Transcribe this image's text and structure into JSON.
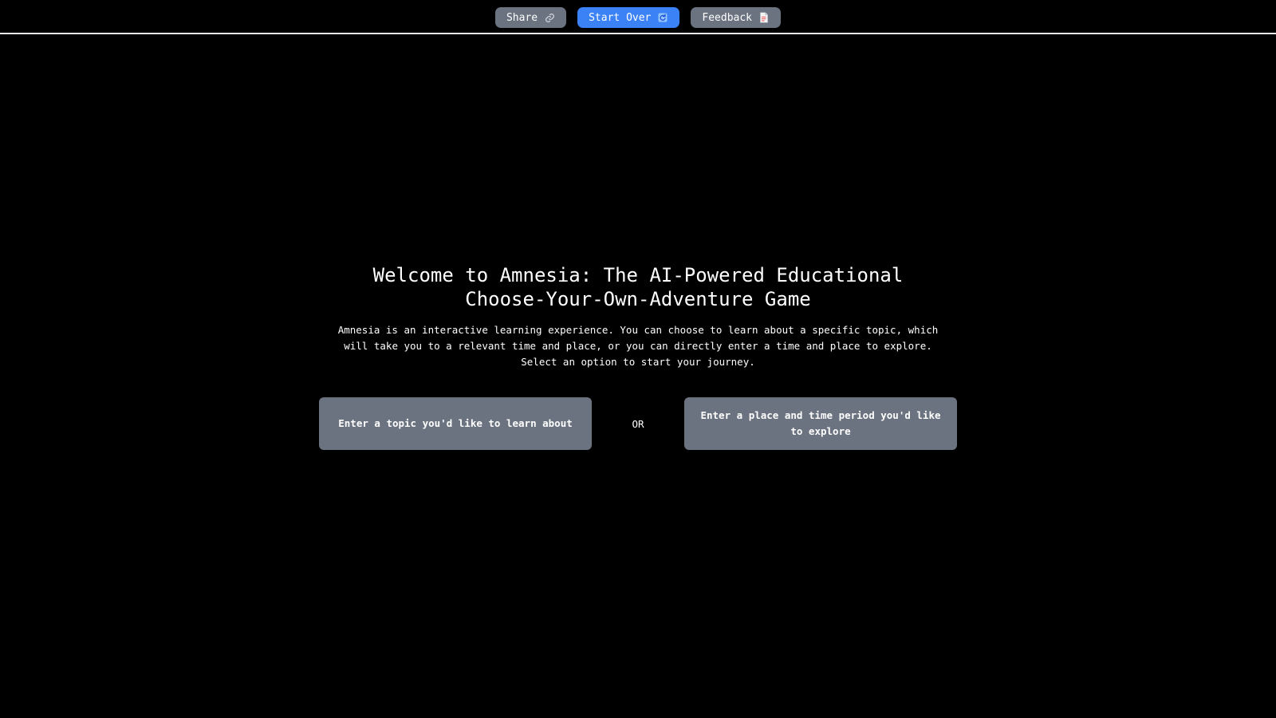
{
  "topbar": {
    "share_label": "Share",
    "start_over_label": "Start Over",
    "feedback_label": "Feedback",
    "share_icon": "link-icon",
    "start_over_icon": "restart-icon",
    "feedback_icon": "document-icon"
  },
  "main": {
    "title": "Welcome to Amnesia: The AI-Powered Educational Choose-Your-Own-Adventure Game",
    "description": "Amnesia is an interactive learning experience. You can choose to learn about a specific topic, which will take you to a relevant time and place, or you can directly enter a time and place to explore. Select an option to start your journey.",
    "topic_option_label": "Enter a topic you'd like to learn about",
    "or_label": "OR",
    "place_option_label": "Enter a place and time period you'd like to explore"
  },
  "colors": {
    "background": "#000000",
    "gray_button": "#6b7280",
    "accent_blue": "#3b82f6",
    "divider": "#e5e7eb"
  }
}
